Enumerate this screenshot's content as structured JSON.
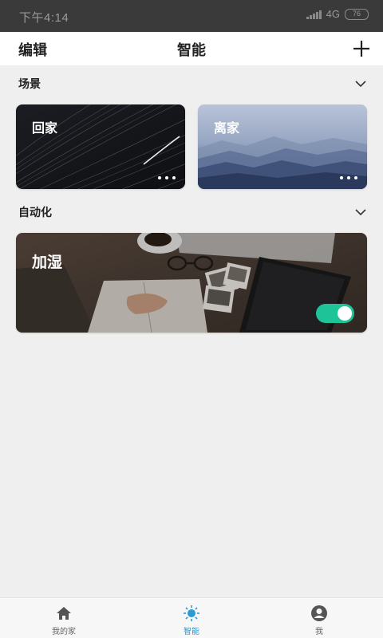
{
  "status_bar": {
    "time": "下午4:14",
    "network": "4G",
    "battery": "76"
  },
  "header": {
    "edit_label": "编辑",
    "title": "智能",
    "add_icon": "plus-icon"
  },
  "scenes_section": {
    "label": "场景",
    "toggle_icon": "chevron-down-icon",
    "cards": [
      {
        "name": "回家",
        "image": "star-trails-night-sky"
      },
      {
        "name": "离家",
        "image": "misty-mountains"
      }
    ]
  },
  "automation_section": {
    "label": "自动化",
    "toggle_icon": "chevron-down-icon",
    "cards": [
      {
        "name": "加湿",
        "image": "desk-with-notebook-and-tablet",
        "enabled": true
      }
    ]
  },
  "bottom_nav": {
    "items": [
      {
        "label": "我的家",
        "icon": "home-icon",
        "active": false
      },
      {
        "label": "智能",
        "icon": "sun-icon",
        "active": true
      },
      {
        "label": "我",
        "icon": "user-icon",
        "active": false
      }
    ]
  },
  "colors": {
    "toggle_on": "#1ec497",
    "nav_active": "#2a9bd6",
    "background": "#efefef"
  }
}
